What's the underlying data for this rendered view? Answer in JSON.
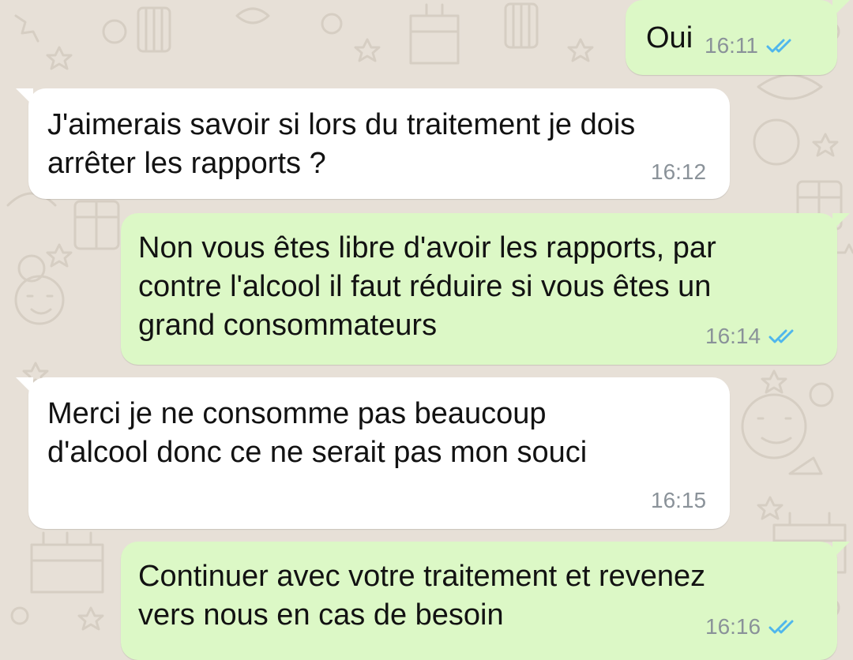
{
  "messages": [
    {
      "direction": "outgoing",
      "text": "Oui",
      "time": "16:11",
      "status_icon": "double-check-read-icon"
    },
    {
      "direction": "incoming",
      "text": "J'aimerais savoir si lors du traitement je dois\narrêter les rapports ?",
      "time": "16:12"
    },
    {
      "direction": "outgoing",
      "text": "Non vous êtes libre d'avoir les rapports, par\ncontre l'alcool il faut réduire si vous êtes un\ngrand consommateurs",
      "time": "16:14",
      "status_icon": "double-check-read-icon"
    },
    {
      "direction": "incoming",
      "text": "Merci je ne consomme pas beaucoup\nd'alcool donc ce ne serait pas mon souci",
      "time": "16:15"
    },
    {
      "direction": "outgoing",
      "text": "Continuer avec votre traitement et revenez\nvers nous en cas de besoin",
      "time": "16:16",
      "status_icon": "double-check-read-icon"
    }
  ],
  "colors": {
    "background": "#e7e0d7",
    "outgoing_bubble": "#dcf8c6",
    "incoming_bubble": "#ffffff",
    "read_ticks": "#4fb6ec",
    "time_text": "#8a9299"
  }
}
